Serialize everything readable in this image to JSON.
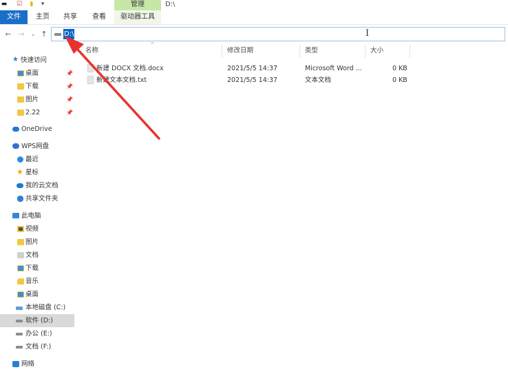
{
  "titlebar": {
    "manage_tab": "管理",
    "path_title": "D:\\"
  },
  "ribbon": {
    "tabs": [
      "文件",
      "主页",
      "共享",
      "查看"
    ],
    "context_tab": "驱动器工具"
  },
  "address": {
    "value": "D:\\"
  },
  "sidebar": {
    "items": [
      {
        "label": "快速访问",
        "icon": "quick-access-star-icon",
        "pinned": false
      },
      {
        "label": "桌面",
        "icon": "desktop-folder-icon",
        "pinned": true
      },
      {
        "label": "下载",
        "icon": "downloads-folder-icon",
        "pinned": true
      },
      {
        "label": "图片",
        "icon": "pictures-folder-icon",
        "pinned": true
      },
      {
        "label": "2.22",
        "icon": "folder-icon",
        "pinned": true
      },
      {
        "label": "OneDrive",
        "icon": "onedrive-cloud-icon",
        "pinned": false
      },
      {
        "label": "WPS网盘",
        "icon": "wps-cloud-icon",
        "pinned": false
      },
      {
        "label": "最近",
        "icon": "clock-icon",
        "pinned": false
      },
      {
        "label": "星标",
        "icon": "star-icon",
        "pinned": false
      },
      {
        "label": "我的云文档",
        "icon": "cloud-docs-icon",
        "pinned": false
      },
      {
        "label": "共享文件夹",
        "icon": "shared-folder-icon",
        "pinned": false
      },
      {
        "label": "此电脑",
        "icon": "this-pc-icon",
        "pinned": false
      },
      {
        "label": "视频",
        "icon": "videos-folder-icon",
        "pinned": false
      },
      {
        "label": "图片",
        "icon": "pictures-folder-icon",
        "pinned": false
      },
      {
        "label": "文档",
        "icon": "documents-folder-icon",
        "pinned": false
      },
      {
        "label": "下载",
        "icon": "downloads-folder-icon",
        "pinned": false
      },
      {
        "label": "音乐",
        "icon": "music-folder-icon",
        "pinned": false
      },
      {
        "label": "桌面",
        "icon": "desktop-folder-icon",
        "pinned": false
      },
      {
        "label": "本地磁盘 (C:)",
        "icon": "local-disk-icon",
        "pinned": false
      },
      {
        "label": "软件 (D:)",
        "icon": "drive-icon",
        "pinned": false,
        "selected": true
      },
      {
        "label": "办公 (E:)",
        "icon": "drive-icon",
        "pinned": false
      },
      {
        "label": "文档 (F:)",
        "icon": "drive-icon",
        "pinned": false
      },
      {
        "label": "网络",
        "icon": "network-icon",
        "pinned": false
      }
    ]
  },
  "file_list": {
    "columns": [
      "名称",
      "修改日期",
      "类型",
      "大小"
    ],
    "rows": [
      {
        "name": "新建 DOCX 文档.docx",
        "date": "2021/5/5 14:37",
        "type": "Microsoft Word ...",
        "size": "0 KB",
        "icon": "docx-file-icon"
      },
      {
        "name": "新建文本文档.txt",
        "date": "2021/5/5 14:37",
        "type": "文本文档",
        "size": "0 KB",
        "icon": "txt-file-icon"
      }
    ]
  },
  "annotation": {
    "arrow_color": "#e8322f"
  }
}
